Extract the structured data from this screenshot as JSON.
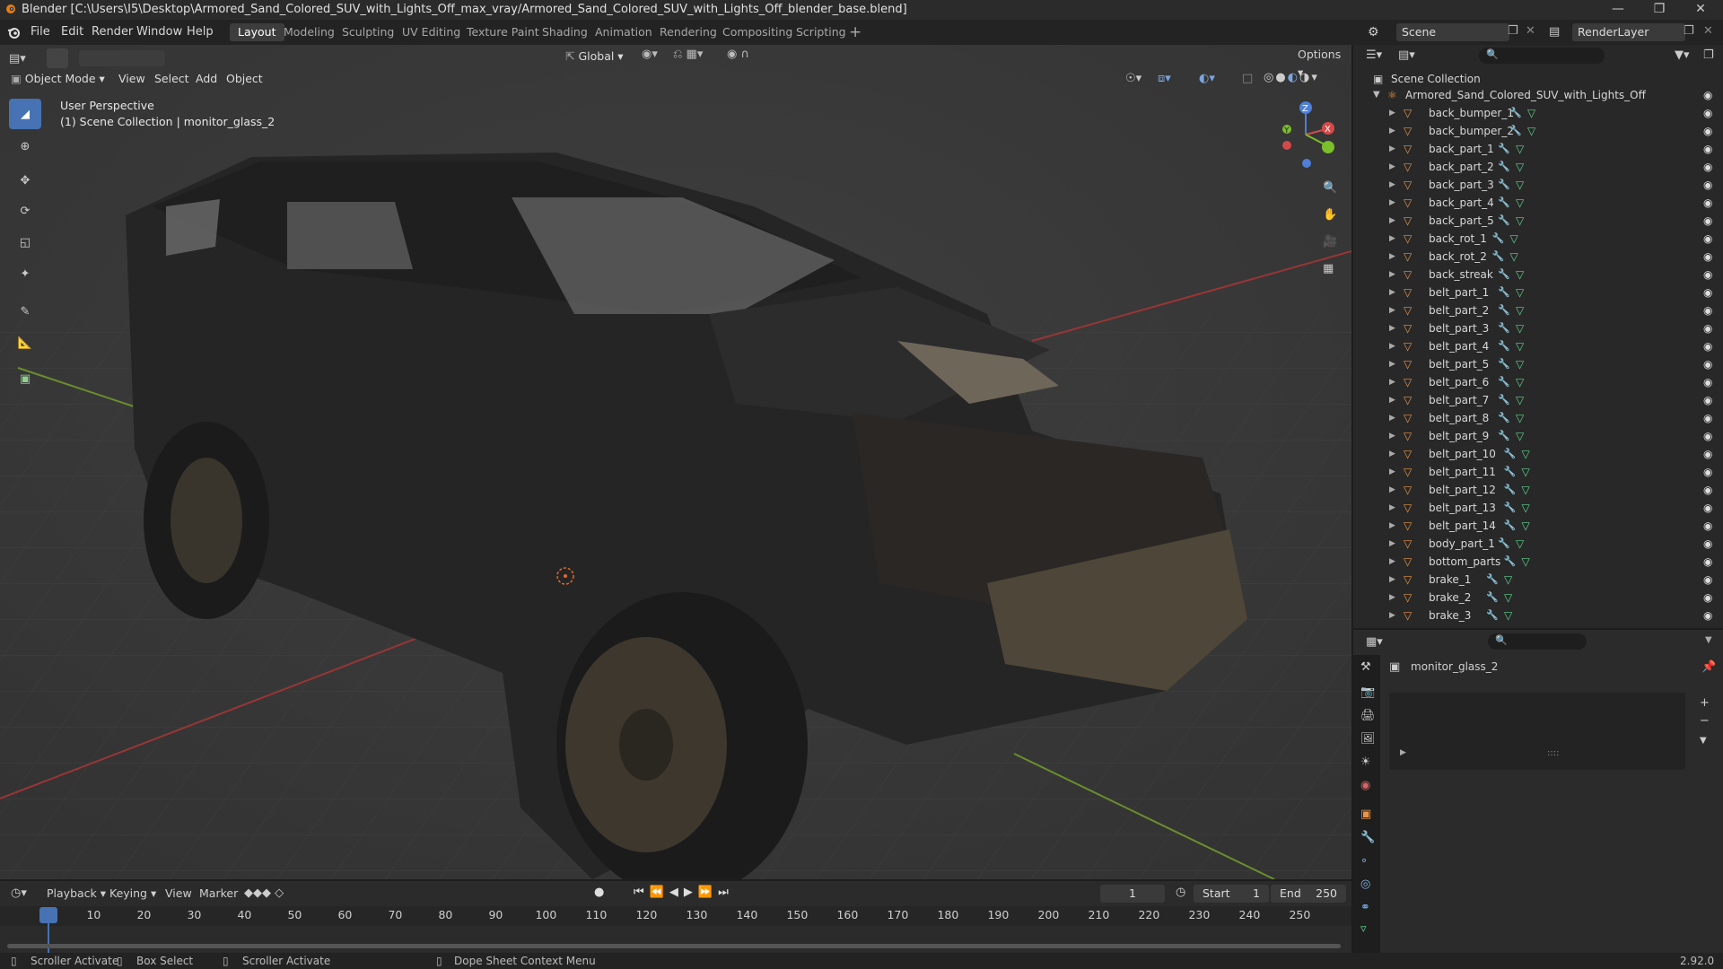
{
  "window": {
    "title": "Blender [C:\\Users\\I5\\Desktop\\Armored_Sand_Colored_SUV_with_Lights_Off_max_vray/Armored_Sand_Colored_SUV_with_Lights_Off_blender_base.blend]"
  },
  "menu": [
    "File",
    "Edit",
    "Render",
    "Window",
    "Help"
  ],
  "workspaces": [
    "Layout",
    "Modeling",
    "Sculpting",
    "UV Editing",
    "Texture Paint",
    "Shading",
    "Animation",
    "Rendering",
    "Compositing",
    "Scripting"
  ],
  "active_workspace": "Layout",
  "scene": {
    "name": "Scene",
    "render_layer": "RenderLayer"
  },
  "toolbar": {
    "orientation": "Global",
    "options_label": "Options"
  },
  "viewport_header": {
    "mode": "Object Mode",
    "menus": [
      "View",
      "Select",
      "Add",
      "Object"
    ]
  },
  "viewport": {
    "perspective_label": "User Perspective",
    "collection_label": "(1) Scene Collection | monitor_glass_2"
  },
  "outliner": {
    "root": "Scene Collection",
    "collection": "Armored_Sand_Colored_SUV_with_Lights_Off",
    "items": [
      "back_bumper_1",
      "back_bumper_2",
      "back_part_1",
      "back_part_2",
      "back_part_3",
      "back_part_4",
      "back_part_5",
      "back_rot_1",
      "back_rot_2",
      "back_streak",
      "belt_part_1",
      "belt_part_2",
      "belt_part_3",
      "belt_part_4",
      "belt_part_5",
      "belt_part_6",
      "belt_part_7",
      "belt_part_8",
      "belt_part_9",
      "belt_part_10",
      "belt_part_11",
      "belt_part_12",
      "belt_part_13",
      "belt_part_14",
      "body_part_1",
      "bottom_parts",
      "brake_1",
      "brake_2",
      "brake_3"
    ]
  },
  "properties": {
    "object_name": "monitor_glass_2",
    "dots": "::::"
  },
  "timeline": {
    "menus": [
      "Playback",
      "Keying",
      "View",
      "Marker"
    ],
    "current_frame": "1",
    "start_label": "Start",
    "start": "1",
    "end_label": "End",
    "end": "250",
    "ticks": [
      "1",
      "10",
      "20",
      "30",
      "40",
      "50",
      "60",
      "70",
      "80",
      "90",
      "100",
      "110",
      "120",
      "130",
      "140",
      "150",
      "160",
      "170",
      "180",
      "190",
      "200",
      "210",
      "220",
      "230",
      "240",
      "250"
    ]
  },
  "statusbar": {
    "items": [
      "Scroller Activate",
      "Box Select",
      "Scroller Activate",
      "Dope Sheet Context Menu"
    ],
    "version": "2.92.0"
  },
  "colors": {
    "accent": "#4772b3",
    "mesh_orange": "#e8954a",
    "modifier_blue": "#7fb0e8",
    "data_green": "#5fd38d"
  }
}
